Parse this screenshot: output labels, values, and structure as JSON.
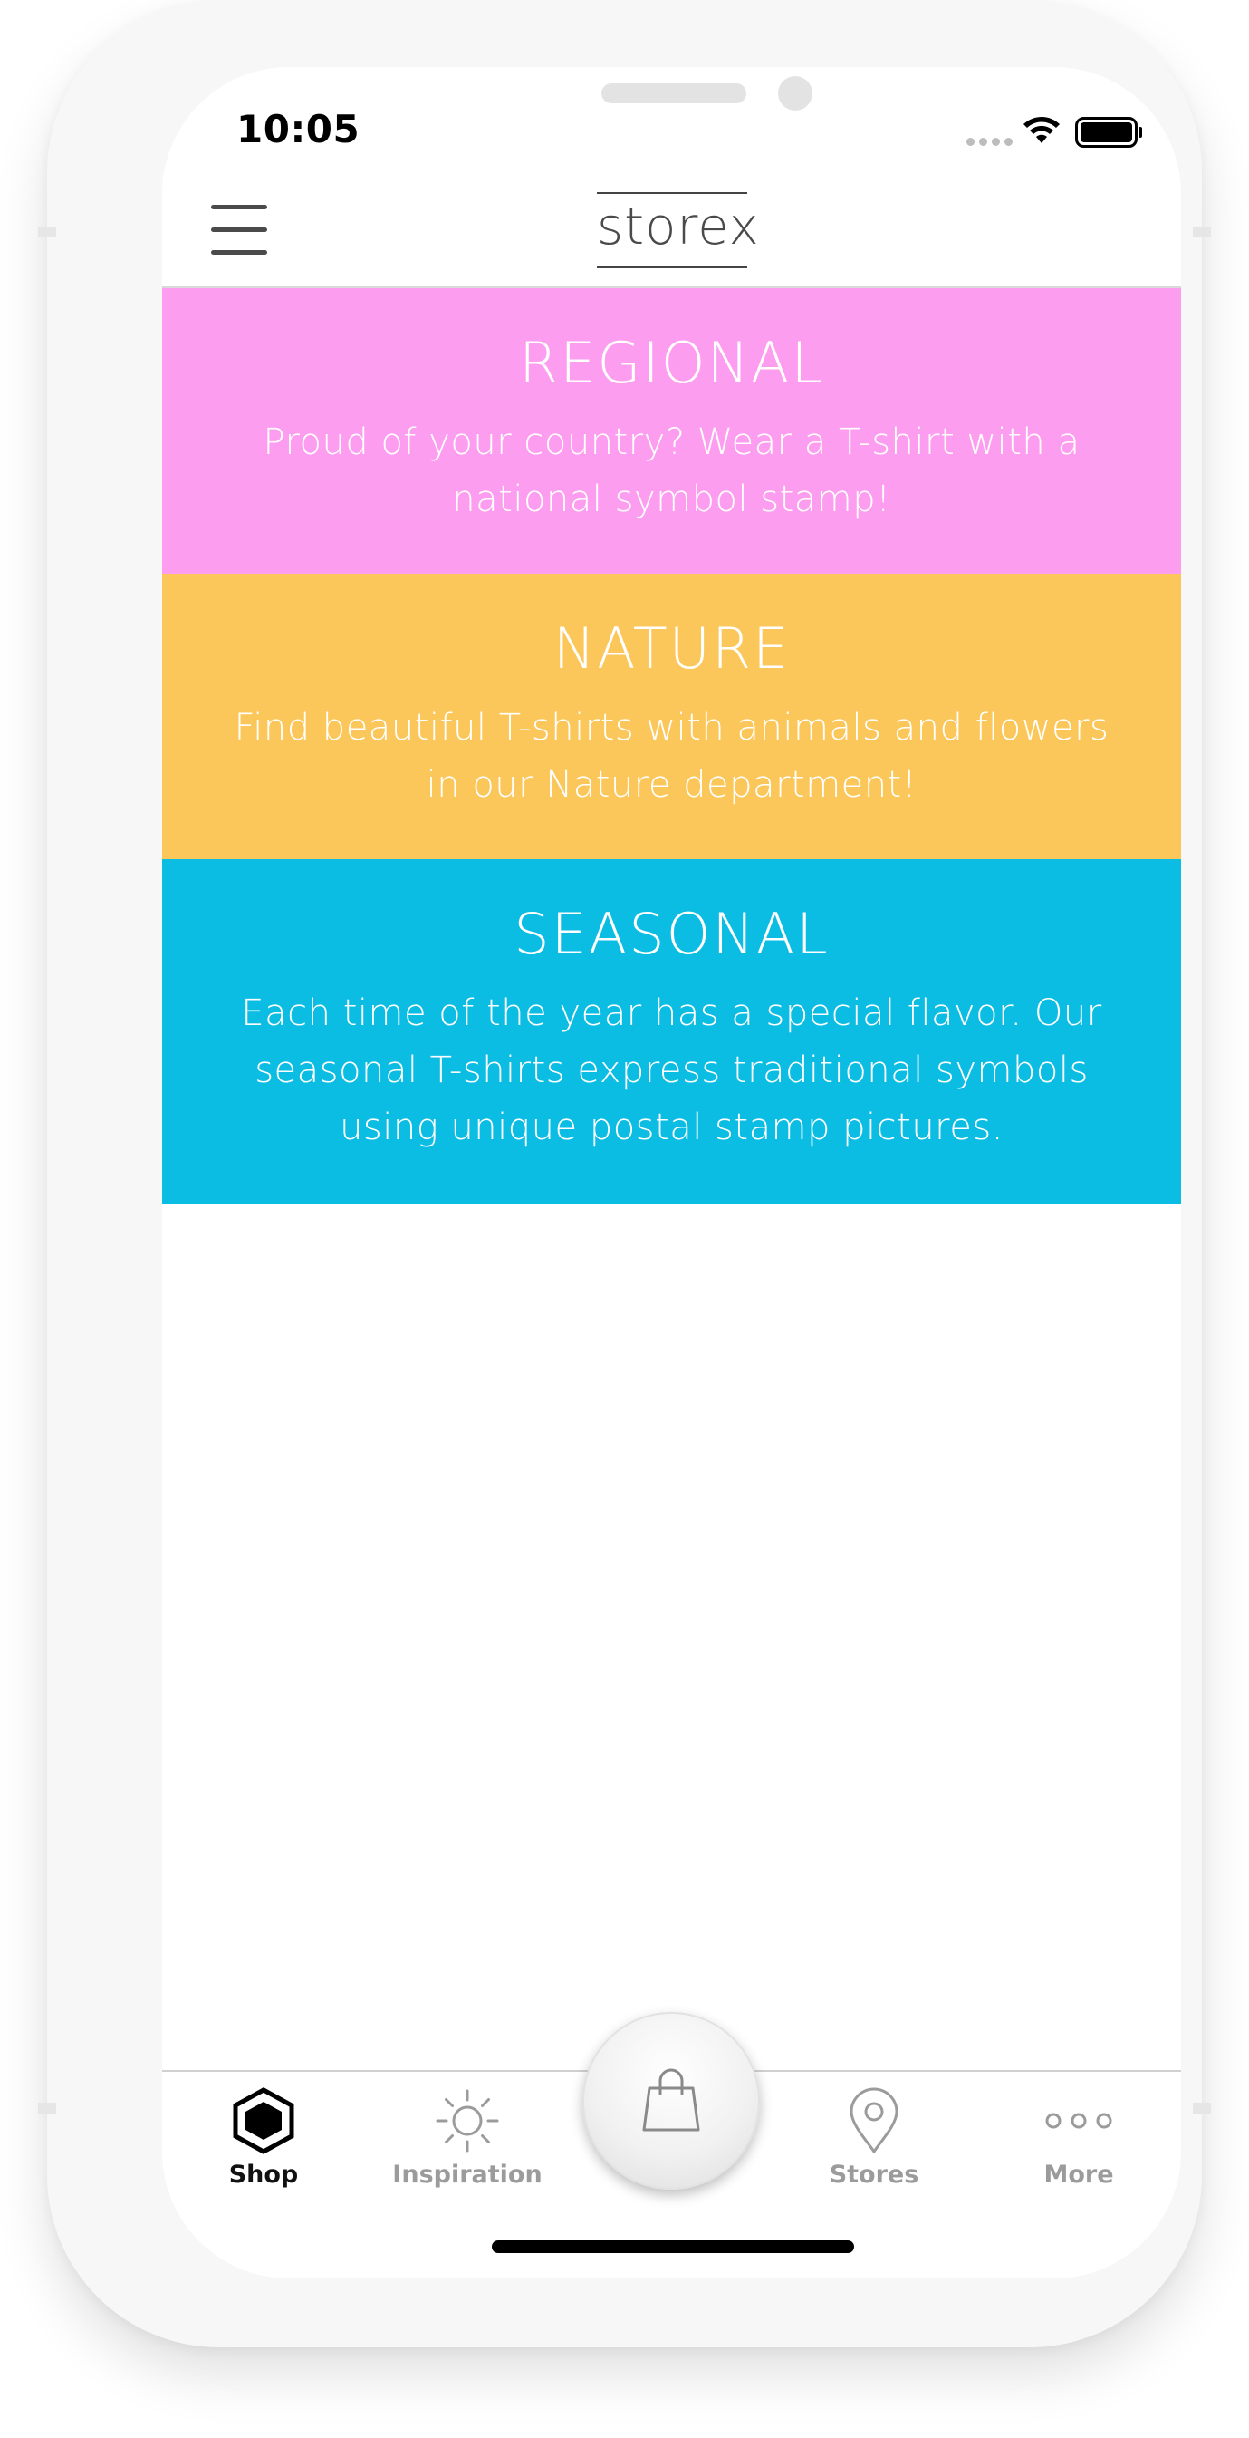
{
  "status_bar": {
    "time": "10:05"
  },
  "header": {
    "logo": "storex"
  },
  "categories": [
    {
      "title": "REGIONAL",
      "description": "Proud of your country? Wear a T-shirt with a national symbol stamp!",
      "color": "#fc9df0"
    },
    {
      "title": "NATURE",
      "description": "Find beautiful T-shirts with animals and flowers in our Nature department!",
      "color": "#fbc75a"
    },
    {
      "title": "SEASONAL",
      "description": "Each time of the year has a special flavor. Our seasonal T-shirts express traditional symbols using unique postal stamp pictures.",
      "color": "#0bbce3"
    }
  ],
  "tabs": [
    {
      "label": "Shop",
      "icon": "hexagon-icon",
      "active": true
    },
    {
      "label": "Inspiration",
      "icon": "sun-icon",
      "active": false
    },
    {
      "label": "",
      "icon": "shopping-bag-icon",
      "active": false
    },
    {
      "label": "Stores",
      "icon": "location-pin-icon",
      "active": false
    },
    {
      "label": "More",
      "icon": "more-dots-icon",
      "active": false
    }
  ]
}
